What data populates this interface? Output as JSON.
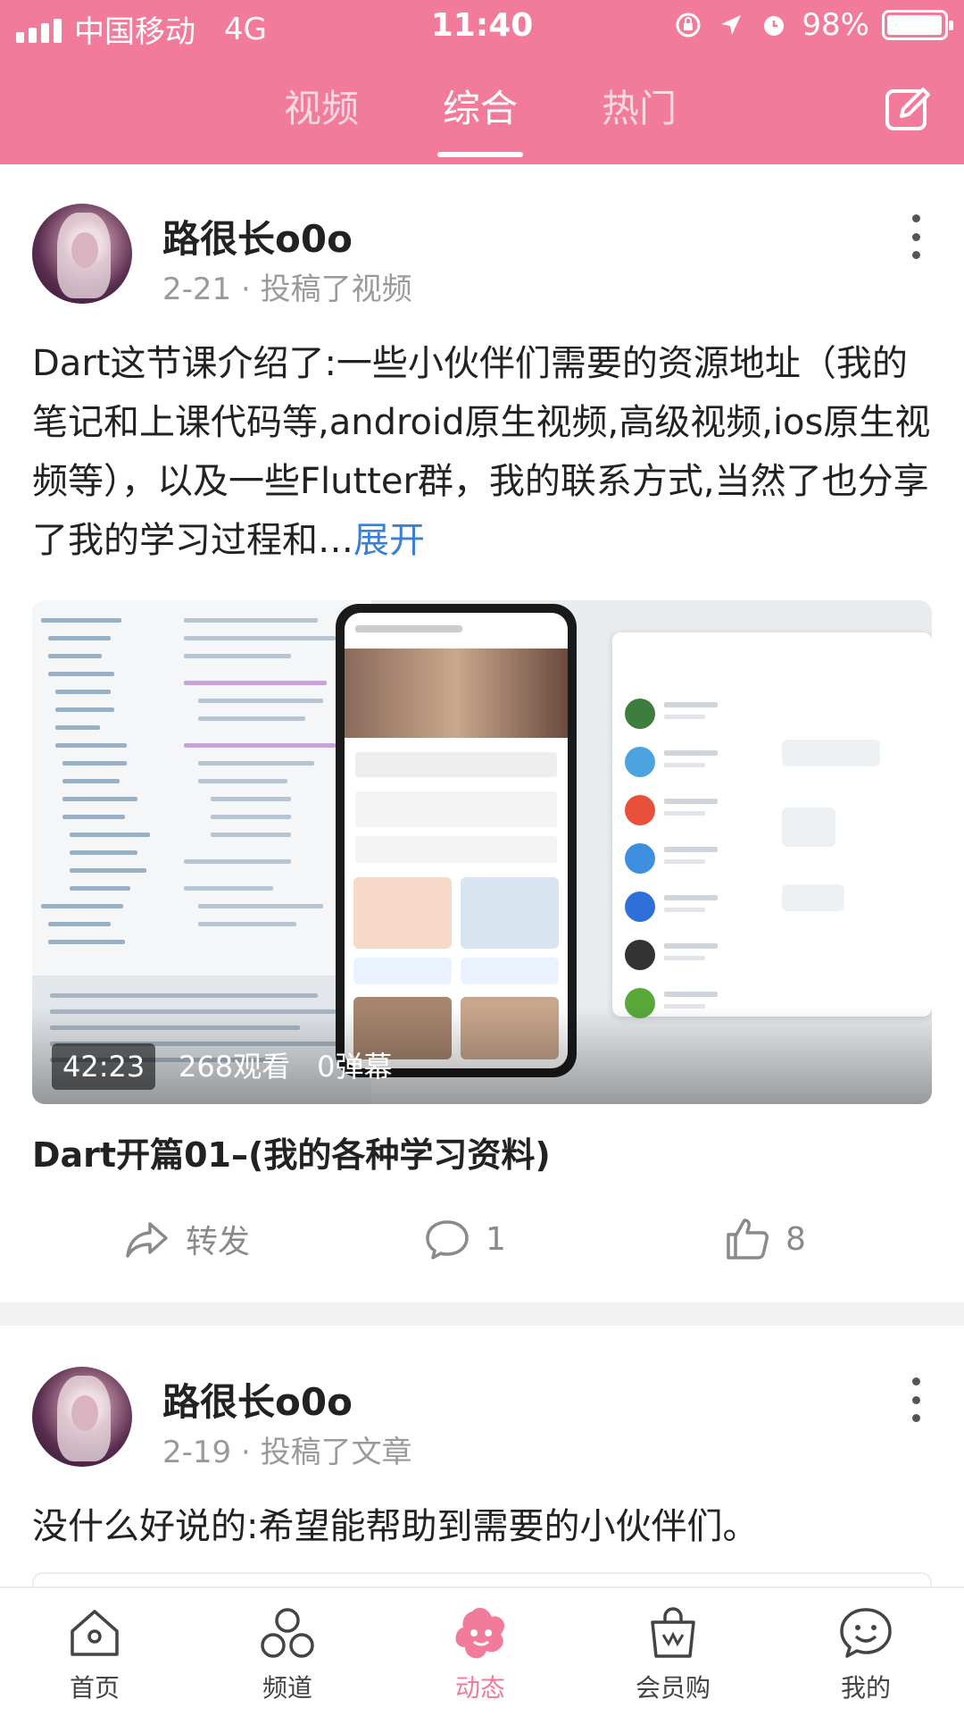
{
  "status_bar": {
    "carrier": "中国移动",
    "network": "4G",
    "time": "11:40",
    "battery_percent": "98%",
    "battery_level": 0.98
  },
  "tabs": [
    {
      "label": "视频",
      "active": false
    },
    {
      "label": "综合",
      "active": true
    },
    {
      "label": "热门",
      "active": false
    }
  ],
  "posts": [
    {
      "author": "路很长o0o",
      "meta": "2-21 · 投稿了视频",
      "text": "Dart这节课介绍了:一些小伙伴们需要的资源地址（我的笔记和上课代码等,android原生视频,高级视频,ios原生视频等），以及一些Flutter群，我的联系方式,当然了也分享了我的学习过程和…",
      "expand_label": "展开",
      "video": {
        "duration": "42:23",
        "views": "268观看",
        "danmaku": "0弹幕",
        "title": "Dart开篇01–(我的各种学习资料)"
      },
      "actions": {
        "share_label": "转发",
        "comment_count": "1",
        "like_count": "8"
      }
    },
    {
      "author": "路很长o0o",
      "meta": "2-19 · 投稿了文章",
      "text": "没什么好说的:希望能帮助到需要的小伙伴们。"
    }
  ],
  "bottom_nav": [
    {
      "label": "首页",
      "icon": "home-icon",
      "active": false
    },
    {
      "label": "频道",
      "icon": "channel-icon",
      "active": false
    },
    {
      "label": "动态",
      "icon": "feed-icon",
      "active": true
    },
    {
      "label": "会员购",
      "icon": "shopping-bag-icon",
      "active": false
    },
    {
      "label": "我的",
      "icon": "profile-icon",
      "active": false
    }
  ],
  "colors": {
    "brand_pink": "#f27b9b",
    "link_blue": "#3b7fd6",
    "meta_gray": "#9a9a9a"
  }
}
